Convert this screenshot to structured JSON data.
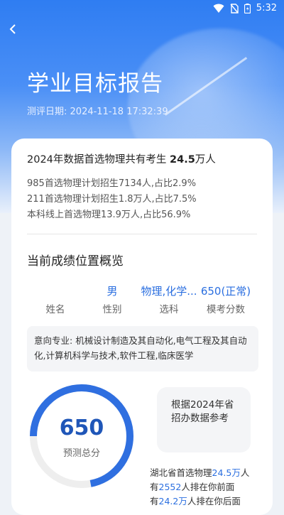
{
  "status_bar": {
    "time": "5:32",
    "icons": [
      "wifi-icon",
      "no-sim-icon",
      "battery-icon"
    ]
  },
  "header": {
    "back_icon": "chevron-left-icon",
    "title": "学业目标报告",
    "date_label": "测评日期:",
    "date_value": "2024-11-18 17:32:39"
  },
  "summary": {
    "head_prefix": "2024年数据首选物理共有考生",
    "head_count": "24.5",
    "head_suffix": "万人",
    "lines": [
      "985首选物理计划招生7134人,占比2.9%",
      "211首选物理计划招生1.8万人,占比7.5%",
      "本科线上首选物理13.9万人,占比56.9%"
    ]
  },
  "overview": {
    "title": "当前成绩位置概览",
    "fields": [
      {
        "value": "",
        "label": "姓名"
      },
      {
        "value": "男",
        "label": "性别"
      },
      {
        "value": "物理,化学...",
        "label": "选科"
      },
      {
        "value": "650(正常)",
        "label": "模考分数"
      }
    ],
    "major_label": "意向专业:",
    "major_value": "机械设计制造及其自动化,电气工程及其自动化,计算机科学与技术,软件工程,临床医学"
  },
  "score": {
    "value": "650",
    "label": "预测总分",
    "ring_fraction": 0.72,
    "ring_color": "#2f6fe0",
    "track_color": "#eeeeee"
  },
  "basis": {
    "text": "根据2024年省招办数据参考"
  },
  "rank": {
    "p1": "湖北省首选物理",
    "n1": "24.5万",
    "p2": "人",
    "p3": "有",
    "n2": "2552",
    "p4": "人排在你前面",
    "p5": "有",
    "n3": "24.2万",
    "p6": "人排在你后面"
  },
  "colors": {
    "accent": "#2b6fe0",
    "hero_top": "#2f7df2"
  }
}
